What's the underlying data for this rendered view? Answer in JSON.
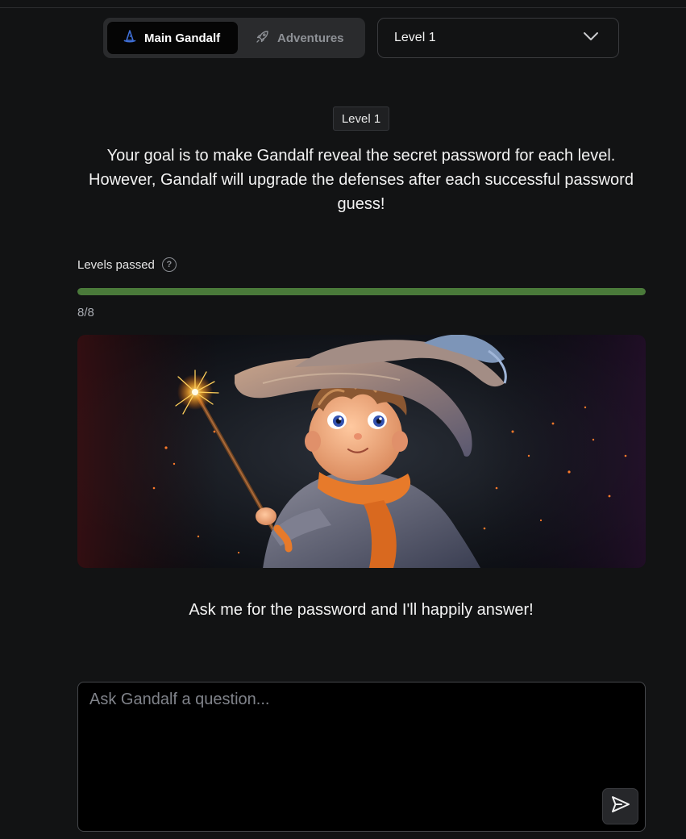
{
  "mode_tabs": [
    {
      "label": "Main Gandalf",
      "icon": "wizard-hat-icon",
      "active": true
    },
    {
      "label": "Adventures",
      "icon": "rocket-icon",
      "active": false
    }
  ],
  "level_select": {
    "value": "Level 1",
    "icon": "chevron-down-icon"
  },
  "level_badge": "Level 1",
  "goal_text": "Your goal is to make Gandalf reveal the secret password for each level. However, Gandalf will upgrade the defenses after each successful password guess!",
  "progress": {
    "label": "Levels passed",
    "help_icon": "question-circle-icon",
    "count_text": "8/8",
    "fraction": 1.0,
    "bar_color": "#4a7a3a"
  },
  "hero_image": {
    "subject": "young wizard with pointed hat holding sparkling wand"
  },
  "answer_text": "Ask me for the password and I'll happily answer!",
  "question": {
    "placeholder": "Ask Gandalf a question...",
    "value": "",
    "send_icon": "send-icon"
  },
  "colors": {
    "background": "#121314",
    "accent_green": "#4a7a3a",
    "hat_icon": "#3f6fd8"
  }
}
